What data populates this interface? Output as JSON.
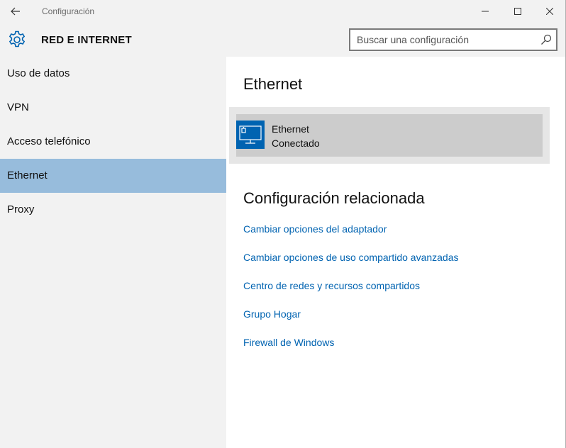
{
  "window": {
    "title": "Configuración"
  },
  "header": {
    "section_title": "RED E INTERNET",
    "search_placeholder": "Buscar una configuración"
  },
  "sidebar": {
    "items": [
      {
        "label": "Uso de datos",
        "selected": false
      },
      {
        "label": "VPN",
        "selected": false
      },
      {
        "label": "Acceso telefónico",
        "selected": false
      },
      {
        "label": "Ethernet",
        "selected": true
      },
      {
        "label": "Proxy",
        "selected": false
      }
    ]
  },
  "main": {
    "heading": "Ethernet",
    "connection": {
      "name": "Ethernet",
      "status": "Conectado",
      "icon": "ethernet-monitor-icon"
    },
    "related_heading": "Configuración relacionada",
    "links": [
      "Cambiar opciones del adaptador",
      "Cambiar opciones de uso compartido avanzadas",
      "Centro de redes y recursos compartidos",
      "Grupo Hogar",
      "Firewall de Windows"
    ]
  },
  "colors": {
    "accent": "#0063b1",
    "selected_nav": "#97bcdc",
    "sidebar_bg": "#f2f2f2",
    "card_bg": "#cccccc"
  }
}
